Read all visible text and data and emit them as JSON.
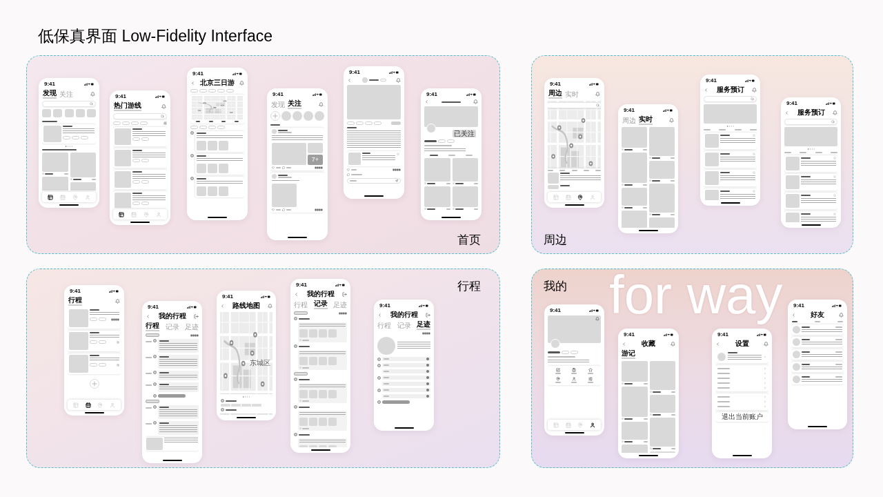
{
  "title": "低保真界面 Low-Fidelity Interface",
  "sections": [
    {
      "label": "首页",
      "phones": [
        {
          "kind": "discover",
          "time": "9:41",
          "header": {
            "kind": "tabs",
            "tabs": [
              {
                "label": "发现",
                "selected": true
              },
              {
                "label": "关注",
                "selected": false
              }
            ]
          },
          "bottom_nav": [
            {
              "selected": true
            },
            {
              "selected": false
            },
            {
              "selected": false
            },
            {
              "selected": false
            }
          ]
        },
        {
          "kind": "route_list",
          "time": "9:41",
          "header": {
            "kind": "tabs",
            "tabs": [
              {
                "label": "热门游线",
                "selected": true
              }
            ]
          },
          "bottom_nav": [
            {
              "selected": true
            },
            {
              "selected": false
            },
            {
              "selected": false
            },
            {
              "selected": false
            }
          ]
        },
        {
          "kind": "route_map",
          "time": "9:41",
          "header": {
            "kind": "title",
            "title": "北京三日游"
          }
        },
        {
          "kind": "following",
          "time": "9:41",
          "header": {
            "kind": "tabs",
            "tabs": [
              {
                "label": "发现",
                "selected": false
              },
              {
                "label": "关注",
                "selected": true
              }
            ]
          },
          "more_count": "7+"
        },
        {
          "kind": "post",
          "time": "9:41",
          "header": {
            "kind": "author"
          }
        },
        {
          "kind": "user_profile",
          "time": "9:41",
          "header": {
            "kind": "title"
          },
          "follow_label": "已关注"
        }
      ]
    },
    {
      "label": "周边",
      "phones": [
        {
          "kind": "nearby_map",
          "time": "9:41",
          "header": {
            "kind": "tabs",
            "tabs": [
              {
                "label": "周边",
                "selected": true
              },
              {
                "label": "实时",
                "selected": false
              }
            ]
          },
          "bottom_nav": [
            {
              "selected": false
            },
            {
              "selected": false
            },
            {
              "selected": true
            },
            {
              "selected": false
            }
          ]
        },
        {
          "kind": "waterfall",
          "time": "9:41",
          "header": {
            "kind": "tabs",
            "tabs": [
              {
                "label": "周边",
                "selected": false
              },
              {
                "label": "实时",
                "selected": true
              }
            ]
          }
        },
        {
          "kind": "service_list",
          "time": "9:41",
          "header": {
            "kind": "title",
            "title": "服务预订"
          }
        },
        {
          "kind": "service_list",
          "time": "9:41",
          "header": {
            "kind": "title",
            "title": "服务预订"
          }
        }
      ]
    },
    {
      "label": "行程",
      "phones": [
        {
          "kind": "trip_cards",
          "time": "9:41",
          "header": {
            "kind": "tabs",
            "tabs": [
              {
                "label": "行程",
                "selected": true
              }
            ]
          },
          "bottom_nav": [
            {
              "selected": false
            },
            {
              "selected": true
            },
            {
              "selected": false
            },
            {
              "selected": false
            }
          ]
        },
        {
          "kind": "timeline",
          "time": "9:41",
          "header": {
            "kind": "trip",
            "title": "我的行程",
            "tabs": [
              {
                "label": "行程",
                "selected": true
              },
              {
                "label": "记录",
                "selected": false
              },
              {
                "label": "足迹",
                "selected": false
              }
            ]
          }
        },
        {
          "kind": "route_map_full",
          "time": "9:41",
          "header": {
            "kind": "title",
            "title": "路线地图"
          },
          "map_label": "东城区"
        },
        {
          "kind": "journal",
          "time": "9:41",
          "header": {
            "kind": "trip",
            "title": "我的行程",
            "tabs": [
              {
                "label": "行程",
                "selected": false
              },
              {
                "label": "记录",
                "selected": true
              },
              {
                "label": "足迹",
                "selected": false
              }
            ]
          }
        },
        {
          "kind": "footprint",
          "time": "9:41",
          "header": {
            "kind": "trip",
            "title": "我的行程",
            "tabs": [
              {
                "label": "行程",
                "selected": false
              },
              {
                "label": "记录",
                "selected": false
              },
              {
                "label": "足迹",
                "selected": true
              }
            ]
          }
        }
      ]
    },
    {
      "label": "我的",
      "backdrop_text": "for way",
      "phones": [
        {
          "kind": "my_profile",
          "time": "9:41",
          "bottom_nav": [
            {
              "selected": false
            },
            {
              "selected": false
            },
            {
              "selected": false
            },
            {
              "selected": true
            }
          ]
        },
        {
          "kind": "waterfall",
          "time": "9:41",
          "header": {
            "kind": "title",
            "title": "收藏",
            "tabs": [
              {
                "label": "游记",
                "selected": true
              }
            ]
          }
        },
        {
          "kind": "settings",
          "time": "9:41",
          "header": {
            "kind": "title",
            "title": "设置"
          },
          "logout": "退出当前账户"
        },
        {
          "kind": "friends",
          "time": "9:41",
          "header": {
            "kind": "title",
            "title": "好友"
          }
        }
      ]
    }
  ]
}
